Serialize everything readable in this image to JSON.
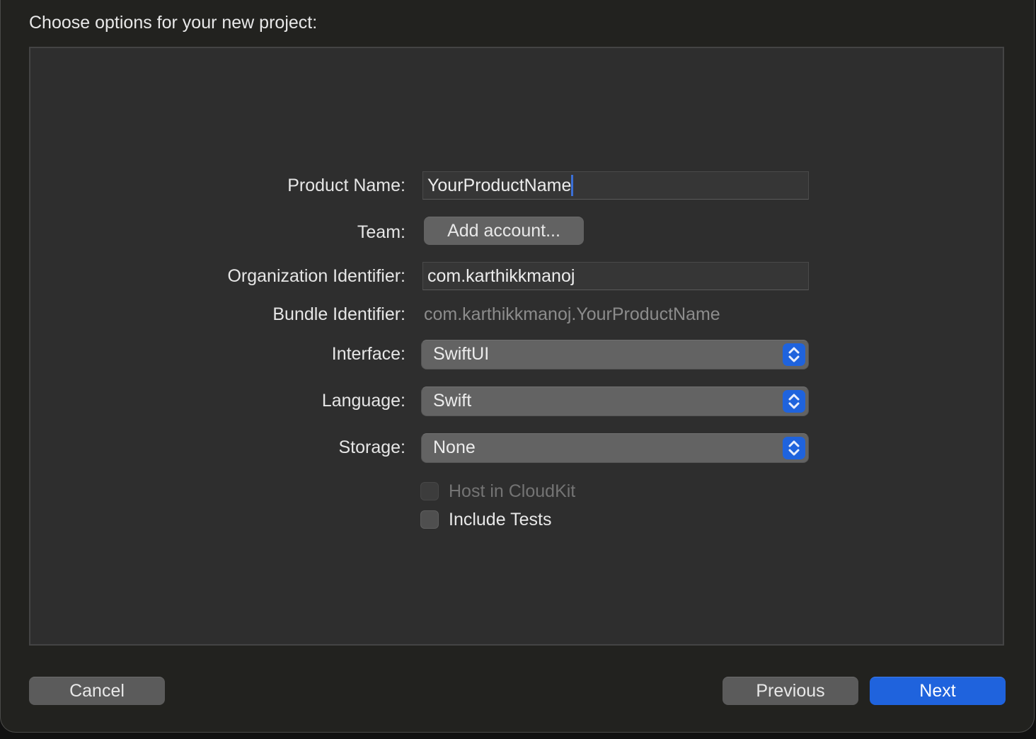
{
  "dialog": {
    "title": "Choose options for your new project:"
  },
  "form": {
    "product_name": {
      "label": "Product Name:",
      "value": "YourProductName"
    },
    "team": {
      "label": "Team:",
      "button": "Add account..."
    },
    "org_identifier": {
      "label": "Organization Identifier:",
      "value": "com.karthikkmanoj"
    },
    "bundle_identifier": {
      "label": "Bundle Identifier:",
      "value": "com.karthikkmanoj.YourProductName"
    },
    "interface": {
      "label": "Interface:",
      "value": "SwiftUI"
    },
    "language": {
      "label": "Language:",
      "value": "Swift"
    },
    "storage": {
      "label": "Storage:",
      "value": "None"
    },
    "host_in_cloudkit": {
      "label": "Host in CloudKit",
      "checked": false,
      "disabled": true
    },
    "include_tests": {
      "label": "Include Tests",
      "checked": false
    }
  },
  "footer": {
    "cancel": "Cancel",
    "previous": "Previous",
    "next": "Next"
  },
  "colors": {
    "accent": "#1f63dd",
    "panel": "#2e2e2e",
    "window": "#22221f"
  }
}
